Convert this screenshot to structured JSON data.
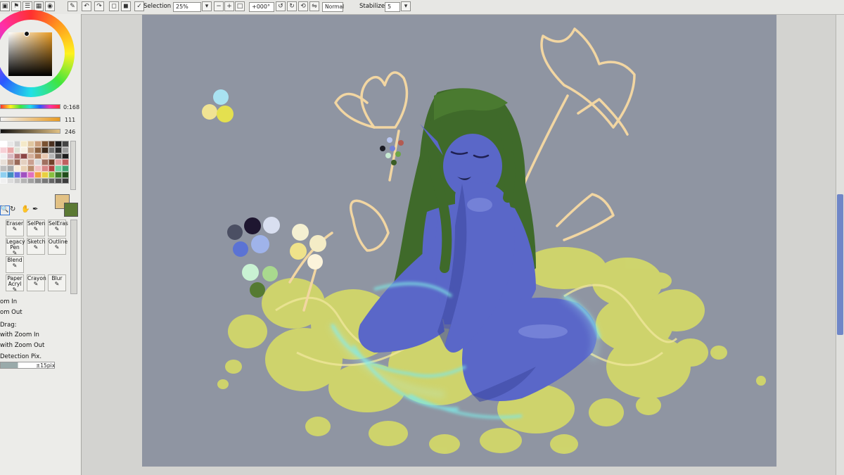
{
  "toolbar": {
    "selection_label": "Selection",
    "selection_checked": true,
    "zoom_value": "25%",
    "rotation_value": "+000°",
    "blend_mode": "Normal",
    "stabilizer_label": "Stabilizer",
    "stabilizer_value": "5"
  },
  "color_panel": {
    "hue_value": "0:168",
    "saturation_value": "111",
    "value_value": "246",
    "primary_color": "#e2c184",
    "secondary_color": "#5c7a34"
  },
  "tools": [
    {
      "label": "Eraser"
    },
    {
      "label": "SelPen"
    },
    {
      "label": "SelEras"
    },
    {
      "label": "Legacy Pen"
    },
    {
      "label": "Sketch"
    },
    {
      "label": "Outline"
    },
    {
      "label": "Blend"
    },
    {
      "label": "Paper Acryl"
    },
    {
      "label": "Crayon"
    },
    {
      "label": "Blur"
    }
  ],
  "navigation": {
    "zoom_in": "om In",
    "zoom_out": "om Out",
    "drag": "Drag:",
    "with_zoom_in": "with Zoom In",
    "with_zoom_out": "with Zoom Out",
    "detection": "Detection Pix.",
    "detection_value": "±15pix"
  },
  "colors": {
    "canvas_bg": "#8f95a2",
    "skin": "#5a67c8",
    "hair": "#3f6a2a",
    "splash": "#d4d968",
    "sketch": "#f4d7a4",
    "glow": "#7fe7e4"
  }
}
